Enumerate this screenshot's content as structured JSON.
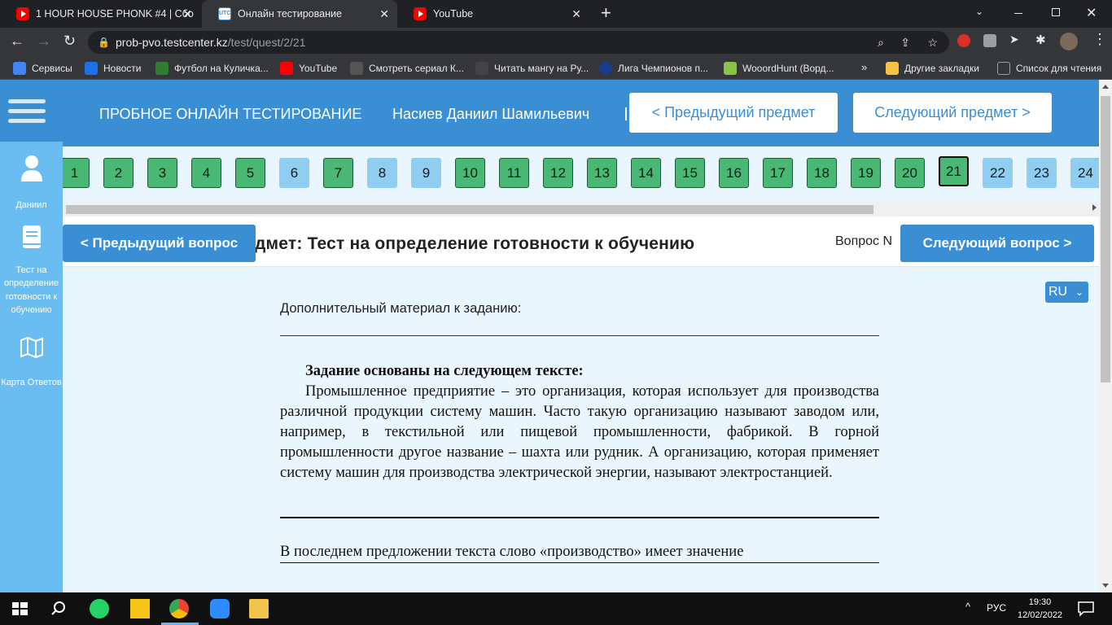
{
  "tabs": [
    {
      "title": "1 HOUR HOUSE PHONK #4 | Сбо",
      "icon": "youtube-icon"
    },
    {
      "title": "Онлайн тестирование",
      "icon": "testcenter-icon"
    },
    {
      "title": "YouTube",
      "icon": "youtube-icon"
    }
  ],
  "address": {
    "host": "prob-pvo.testcenter.kz",
    "path": "/test/quest/2/21"
  },
  "bookmarks": [
    {
      "label": "Сервисы",
      "color": "#4285f4"
    },
    {
      "label": "Новости",
      "color": "#1a73e8"
    },
    {
      "label": "Футбол на Куличка...",
      "color": "#2e7d32"
    },
    {
      "label": "YouTube",
      "color": "#ff0000"
    },
    {
      "label": "Смотреть сериал К...",
      "color": "#555555"
    },
    {
      "label": "Читать мангу на Ру...",
      "color": "#444444"
    },
    {
      "label": "Лига Чемпионов п...",
      "color": "#1a3c8c"
    },
    {
      "label": "WooordHunt (Ворд...",
      "color": "#8bc34a"
    },
    {
      "label": "Другие закладки",
      "color": "#f6c344"
    },
    {
      "label": "Список для чтения",
      "color": "#9aa0a6"
    }
  ],
  "header": {
    "title": "ПРОБНОЕ ОНЛАЙН ТЕСТИРОВАНИЕ",
    "user": "Насиев Даниил Шамильевич",
    "prev_subject": "< Предыдущий предмет",
    "next_subject": "Следующий предмет >"
  },
  "sidebar": {
    "user_label": "Даниил",
    "test_label": "Тест на определение готовности к обучению",
    "map_label": "Карта Ответов"
  },
  "questions": [
    {
      "n": "1",
      "state": "answered"
    },
    {
      "n": "2",
      "state": "answered"
    },
    {
      "n": "3",
      "state": "answered"
    },
    {
      "n": "4",
      "state": "answered"
    },
    {
      "n": "5",
      "state": "answered"
    },
    {
      "n": "6",
      "state": "unanswered"
    },
    {
      "n": "7",
      "state": "answered"
    },
    {
      "n": "8",
      "state": "unanswered"
    },
    {
      "n": "9",
      "state": "unanswered"
    },
    {
      "n": "10",
      "state": "answered"
    },
    {
      "n": "11",
      "state": "answered"
    },
    {
      "n": "12",
      "state": "answered"
    },
    {
      "n": "13",
      "state": "answered"
    },
    {
      "n": "14",
      "state": "answered"
    },
    {
      "n": "15",
      "state": "answered"
    },
    {
      "n": "16",
      "state": "answered"
    },
    {
      "n": "17",
      "state": "answered"
    },
    {
      "n": "18",
      "state": "answered"
    },
    {
      "n": "19",
      "state": "answered"
    },
    {
      "n": "20",
      "state": "answered"
    },
    {
      "n": "21",
      "state": "current"
    },
    {
      "n": "22",
      "state": "unanswered"
    },
    {
      "n": "23",
      "state": "unanswered"
    },
    {
      "n": "24",
      "state": "unanswered"
    }
  ],
  "subject": {
    "title": "дмет: Тест на определение готовности к обучению",
    "question_label": "Вопрос N",
    "prev_question": "< Предыдущий вопрос",
    "next_question": "Следующий вопрос >"
  },
  "language": "RU",
  "content": {
    "additional": "Дополнительный материал к заданию:",
    "task_heading": "Задание основаны на следующем тексте:",
    "task_text": "Промышленное предприятие – это организация, которая использует для производства различной продукции систему машин. Часто такую организацию называют заводом или, например, в текстильной или пищевой промышленности, фабрикой. В горной промышленности другое название – шахта или рудник. А организацию, которая применяет систему машин для производства электрической энергии, называют электростанцией.",
    "question": "В последнем предложении текста слово «производство» имеет значение"
  },
  "taskbar": {
    "lang": "РУС",
    "time": "19:30",
    "date": "12/02/2022"
  },
  "colors": {
    "accent": "#3a8fd4",
    "answered": "#48b874",
    "unanswered": "#8fcdf1",
    "sidebar": "#69bdf1"
  }
}
